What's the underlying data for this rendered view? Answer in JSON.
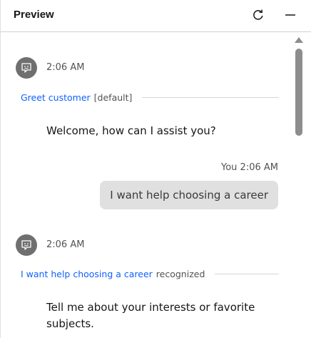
{
  "header": {
    "title": "Preview",
    "refresh_icon": "refresh-icon",
    "minimize_icon": "minimize-icon"
  },
  "messages": [
    {
      "sender": "bot",
      "time": "2:06 AM",
      "intent": {
        "name": "Greet customer",
        "tag": "[default]"
      },
      "text": "Welcome, how can I assist you?"
    },
    {
      "sender": "user",
      "meta": "You 2:06 AM",
      "text": "I want help choosing a career"
    },
    {
      "sender": "bot",
      "time": "2:06 AM",
      "intent": {
        "name": "I want help choosing a career",
        "tag": "recognized"
      },
      "text_line1": "Tell me about your interests or favorite",
      "text_line2": "subjects."
    }
  ],
  "colors": {
    "link": "#0f62fe",
    "avatar": "#6f6f6f",
    "bubble": "#e0e0e0"
  }
}
